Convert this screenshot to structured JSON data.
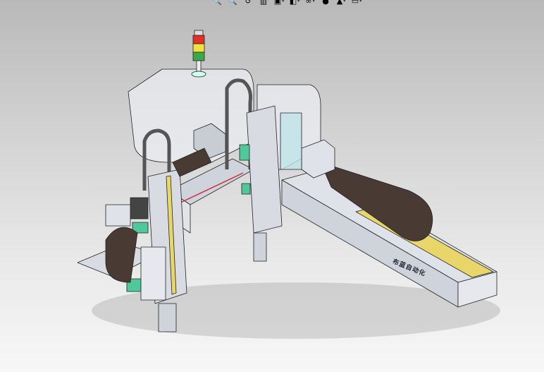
{
  "toolbar": {
    "items": [
      {
        "name": "zoom-to-fit-icon",
        "glyph": "🔍"
      },
      {
        "name": "zoom-to-area-icon",
        "glyph": "🔍"
      },
      {
        "name": "previous-view-icon",
        "glyph": "↺"
      },
      {
        "name": "section-view-icon",
        "glyph": "▥"
      },
      {
        "name": "view-orientation-icon",
        "glyph": "▣",
        "dropdown": true
      },
      {
        "name": "display-style-icon",
        "glyph": "◧",
        "dropdown": true
      },
      {
        "name": "hide-show-items-icon",
        "glyph": "∞",
        "dropdown": true
      },
      {
        "name": "edit-appearance-icon",
        "glyph": "●",
        "dropdown": false
      },
      {
        "name": "apply-scene-icon",
        "glyph": "▲",
        "dropdown": true
      },
      {
        "name": "view-settings-icon",
        "glyph": "▭",
        "dropdown": true
      }
    ]
  },
  "model": {
    "rail_label": "布蓝自动化"
  },
  "colors": {
    "frame": "#d9dce3",
    "belt": "#4a3a34",
    "green": "#4fc89a",
    "yellow": "#e8d66a",
    "outline": "#222222"
  }
}
